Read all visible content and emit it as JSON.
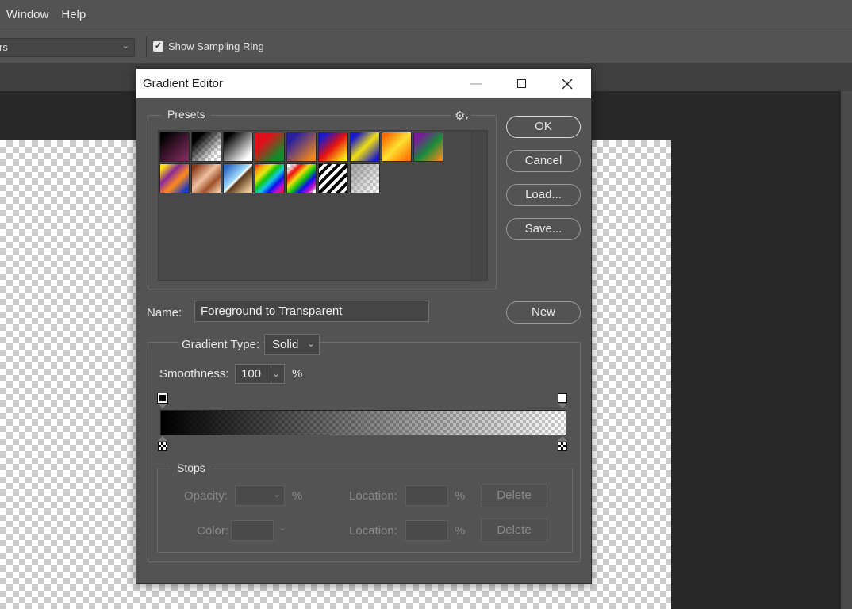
{
  "menu": {
    "items": [
      "Window",
      "Help"
    ]
  },
  "options": {
    "select_text": "rs",
    "show_sampling_ring": "Show Sampling Ring",
    "checked": true
  },
  "dialog": {
    "title": "Gradient Editor",
    "presets_label": "Presets",
    "buttons": {
      "ok": "OK",
      "cancel": "Cancel",
      "load": "Load...",
      "save": "Save...",
      "new": "New"
    },
    "name_label": "Name:",
    "name_value": "Foreground to Transparent",
    "gradient_type_label": "Gradient Type:",
    "gradient_type_value": "Solid",
    "smoothness_label": "Smoothness:",
    "smoothness_value": "100",
    "percent": "%",
    "stops": {
      "label": "Stops",
      "opacity_label": "Opacity:",
      "color_label": "Color:",
      "location_label": "Location:",
      "delete_label": "Delete"
    }
  },
  "presets": [
    {
      "name": "foreground-to-background",
      "css": "linear-gradient(135deg,#000 10%,#7a2a5a 90%)"
    },
    {
      "name": "foreground-to-transparent",
      "css": "linear-gradient(135deg,#000 20%,rgba(0,0,0,0) 80%)"
    },
    {
      "name": "black-white",
      "css": "linear-gradient(135deg,#000 15%,#fff 85%)"
    },
    {
      "name": "red-green",
      "css": "linear-gradient(135deg,#e0101a 30%,#138a2c 80%)"
    },
    {
      "name": "violet-orange",
      "css": "linear-gradient(135deg,#2a1f9e 20%,#f28a1a 90%)"
    },
    {
      "name": "blue-red-yellow",
      "css": "linear-gradient(135deg,#1a1acc 15%,#e51010 50%,#ffe812 90%)"
    },
    {
      "name": "blue-yellow-blue",
      "css": "linear-gradient(135deg,#1a1acc 15%,#f0e010 50%,#1a1acc 90%)"
    },
    {
      "name": "orange-yellow-orange",
      "css": "linear-gradient(135deg,#ff6a00 10%,#ffe030 50%,#ff6a00 95%)"
    },
    {
      "name": "violet-green-orange",
      "css": "linear-gradient(135deg,#7a1a9a 15%,#1a8a3a 55%,#f28a1a 95%)"
    },
    {
      "name": "yellow-violet-orange-blue",
      "css": "linear-gradient(135deg,#ffe012 10%,#8a2a9a 35%,#ff8a1a 60%,#1a3ac8 90%)"
    },
    {
      "name": "copper",
      "css": "linear-gradient(135deg,#8a3a1a 10%,#f0c0a0 45%,#a0522a 70%,#f0c8a8 95%)"
    },
    {
      "name": "chrome",
      "css": "linear-gradient(135deg,#2a6ac8 10%,#a0d8f8 45%,#fff 50%,#5a3a1a 55%,#e8c898 90%)"
    },
    {
      "name": "spectrum",
      "css": "linear-gradient(135deg,#f01010,#f0a010,#e8e810,#10c810,#10c8e8,#1010f0,#c810c8,#f01010)"
    },
    {
      "name": "transparent-rainbow",
      "css": "linear-gradient(135deg,rgba(255,255,255,0) 10%,#f01010 25%,#f0e010 40%,#10c810 55%,#1010f0 70%,#c810c8 85%,rgba(255,255,255,0) 95%)"
    },
    {
      "name": "transparent-stripes",
      "css": "repeating-linear-gradient(135deg,#000 0 4px,#fff 4px 8px)"
    },
    {
      "name": "neutral-density",
      "css": "linear-gradient(135deg,rgba(120,120,120,0.7),rgba(255,255,255,0.1))"
    }
  ]
}
